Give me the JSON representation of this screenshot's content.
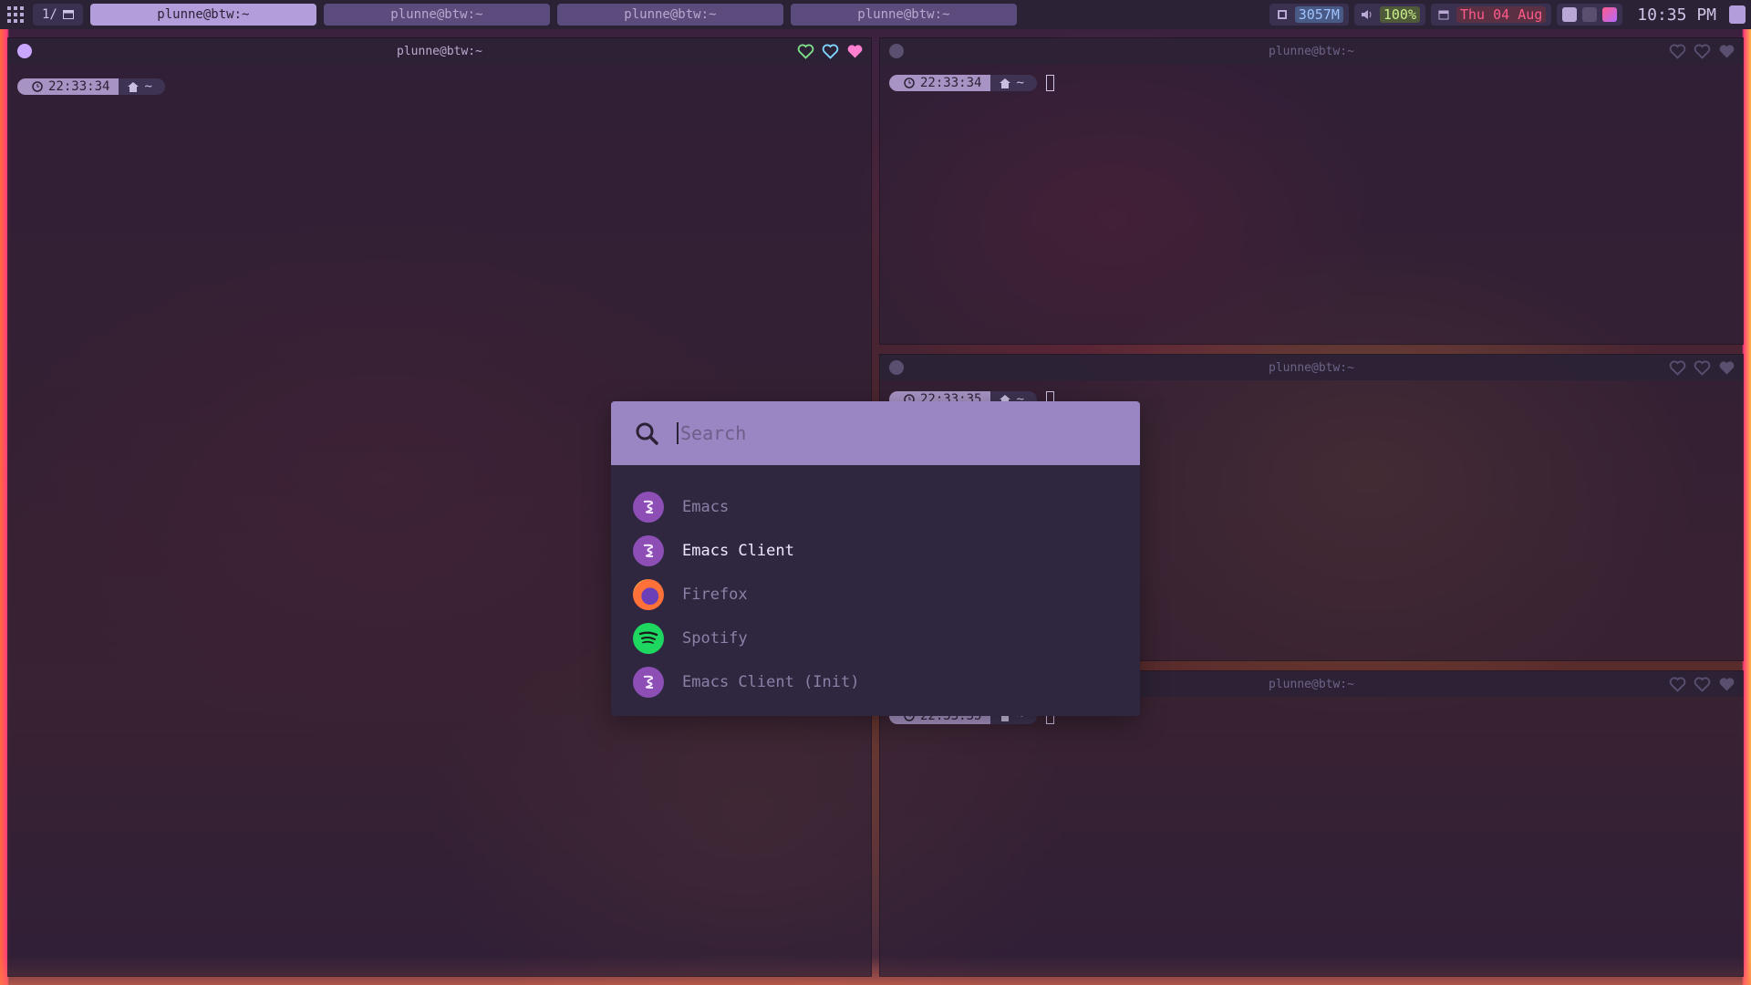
{
  "topbar": {
    "workspace": "1/",
    "tabs": [
      "plunne@btw:~",
      "plunne@btw:~",
      "plunne@btw:~",
      "plunne@btw:~"
    ],
    "memory": "3057M",
    "volume": "100%",
    "date": "Thu 04 Aug",
    "clock": "10:35 PM"
  },
  "windows": [
    {
      "title": "plunne@btw:~",
      "time": "22:33:34",
      "dir": "~"
    },
    {
      "title": "plunne@btw:~",
      "time": "22:33:34",
      "dir": "~"
    },
    {
      "title": "plunne@btw:~",
      "time": "22:33:35",
      "dir": "~"
    },
    {
      "title": "plunne@btw:~",
      "time": "22:33:35",
      "dir": "~"
    }
  ],
  "launcher": {
    "placeholder": "Search",
    "items": [
      {
        "label": "Emacs",
        "icon": "emacs-icon"
      },
      {
        "label": "Emacs Client",
        "icon": "emacs-icon"
      },
      {
        "label": "Firefox",
        "icon": "firefox-icon"
      },
      {
        "label": "Spotify",
        "icon": "spotify-icon"
      },
      {
        "label": "Emacs Client (Init)",
        "icon": "emacs-icon"
      }
    ],
    "selected_index": 1
  },
  "colors": {
    "accent": "#b39ddb",
    "heart_green": "#7ee08a",
    "heart_blue": "#7fd6ff",
    "heart_pink": "#ff7fd1",
    "date_red": "#ff5a8a"
  }
}
